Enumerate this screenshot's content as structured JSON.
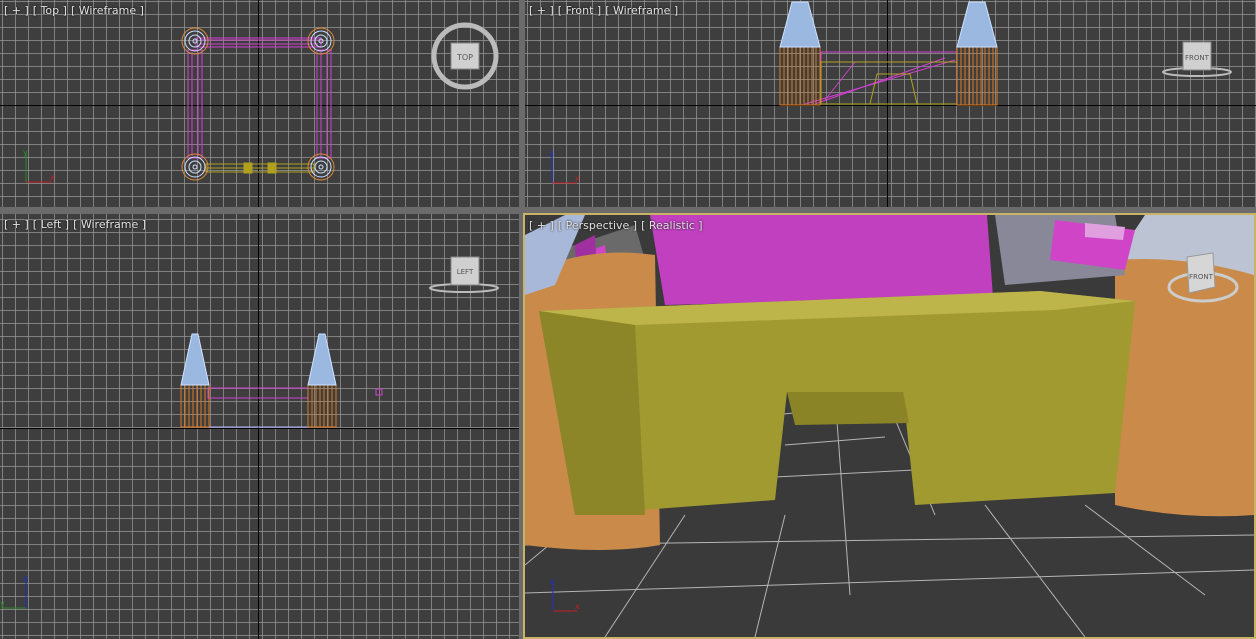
{
  "viewports": {
    "top": {
      "plus": "[ + ]",
      "view": "[ Top ]",
      "shading": "[ Wireframe ]",
      "cube": "TOP"
    },
    "front": {
      "plus": "[ + ]",
      "view": "[ Front ]",
      "shading": "[ Wireframe ]",
      "cube": "FRONT"
    },
    "left": {
      "plus": "[ + ]",
      "view": "[ Left ]",
      "shading": "[ Wireframe ]",
      "cube": "LEFT"
    },
    "persp": {
      "plus": "[ + ]",
      "view": "[ Perspective ]",
      "shading": "[ Realistic ]",
      "cube": "FRONT"
    }
  },
  "axis": {
    "x": "x",
    "y": "y",
    "z": "z"
  },
  "colors": {
    "grid_bg": "#3e3e3e",
    "wall_magenta": "#c040c0",
    "tower_orange": "#d07a2a",
    "roof_blue": "#9ab8e0",
    "gate_olive": "#a09a30",
    "active_border": "#c8b464"
  }
}
